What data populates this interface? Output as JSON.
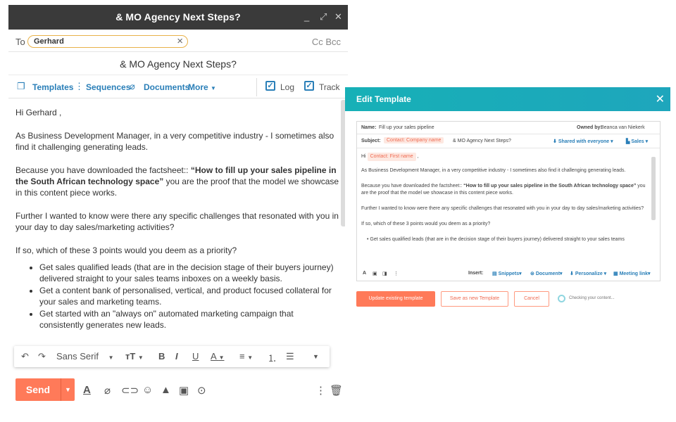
{
  "compose": {
    "window_title": "& MO Agency Next Steps?",
    "controls": [
      "_",
      "⤢",
      "✕"
    ],
    "to_label": "To",
    "recipient": "Gerhard",
    "cc_bcc": "Cc Bcc",
    "subject": "& MO Agency Next Steps?",
    "toolbar": {
      "templates": "Templates",
      "sequences": "Sequences",
      "documents": "Documents",
      "more": "More",
      "log": "Log",
      "track": "Track"
    },
    "body": {
      "greeting": "Hi Gerhard ,",
      "p1": "As Business Development Manager, in a very competitive industry - I sometimes also find it challenging generating leads.",
      "p2_pre": "Because you have downloaded the factsheet:: ",
      "p2_bold": "“How to fill up your sales pipeline in the South African technology space”",
      "p2_post": " you are the proof that the model we showcase in this content piece works.",
      "p3": "Further I wanted to know were there any specific challenges that resonated with you in your day to day sales/marketing activities?",
      "p4": "If so, which of these 3 points would you deem as a priority?",
      "bullets": [
        "Get sales qualified leads (that are in the decision stage of their buyers journey) delivered straight to your sales teams inboxes on a weekly basis.",
        "Get a content bank of personalised, vertical, and product focused collateral for your sales and marketing teams.",
        "Get started with an \"always on\" automated marketing campaign that consistently generates new leads."
      ]
    },
    "format_bar": {
      "font": "Sans Serif"
    },
    "send_label": "Send"
  },
  "template_panel": {
    "title": "Edit Template",
    "name_label": "Name:",
    "name_value": "Fill up your sales pipeline",
    "owned_by_label": "Owned by:",
    "owned_by_value": "Beanca van Niekerk",
    "subject_label": "Subject:",
    "subject_token": "Contact: Company name",
    "subject_text": "& MO Agency Next Steps?",
    "shared": "Shared with everyone",
    "team": "Sales",
    "body": {
      "hi": "Hi",
      "first_name_token": "Contact: First name",
      "comma": ",",
      "p1": "As Business Development Manager, in a very competitive industry - I sometimes also find it challenging generating leads.",
      "p2_pre": "Because you have downloaded the factsheet:: ",
      "p2_bold": "“How to fill up your sales pipeline in the South African technology space”",
      "p2_post": " you are the proof that the model we showcase in this content piece works.",
      "p3": "Further I wanted to know were there any specific challenges that resonated with you in your day to day sales/marketing activities?",
      "p4": "If so, which of these 3 points would you deem as a priority?",
      "bullet1": "Get sales qualified leads (that are in the decision stage of their buyers journey) delivered straight to your sales teams"
    },
    "insert_label": "Insert:",
    "insert_items": [
      "Snippets",
      "Document",
      "Personalize",
      "Meeting link"
    ],
    "buttons": {
      "update": "Update existing template",
      "save_new": "Save as new Template",
      "cancel": "Cancel"
    },
    "checking": "Checking your content..."
  },
  "colors": {
    "accent_orange": "#ff7a59",
    "link_blue": "#2a7fb8",
    "teal_header": "#17b0b7",
    "titlebar": "#3a3a3a"
  }
}
